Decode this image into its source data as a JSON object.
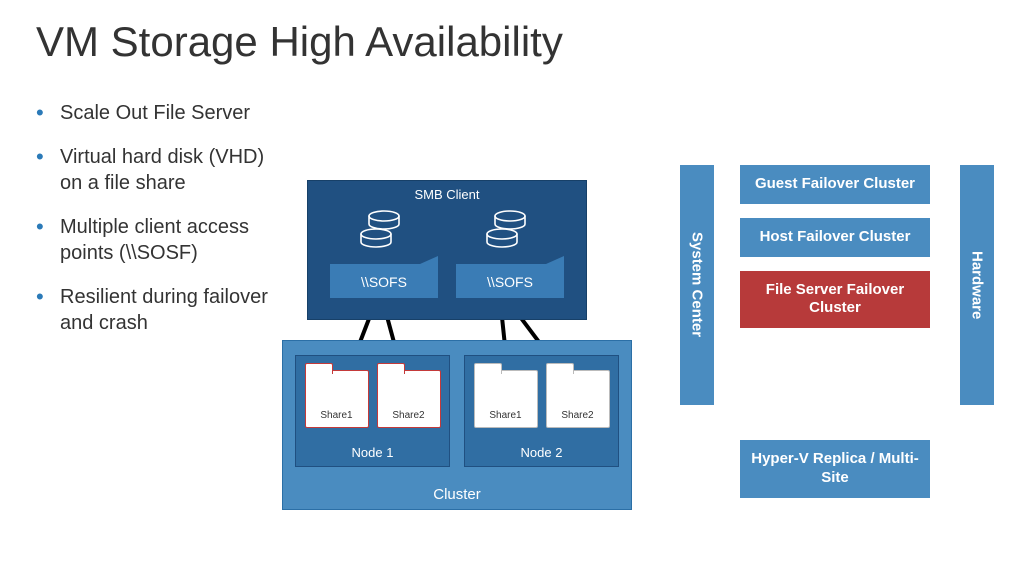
{
  "title": "VM Storage High Availability",
  "bullets": [
    "Scale Out File Server",
    "Virtual hard disk (VHD) on a file share",
    "Multiple client access points (\\\\SOSF)",
    "Resilient during failover and crash"
  ],
  "smb": {
    "label": "SMB Client",
    "sofs": [
      "\\\\SOFS",
      "\\\\SOFS"
    ]
  },
  "cluster": {
    "label": "Cluster",
    "nodes": [
      {
        "label": "Node 1",
        "shares": [
          "Share1",
          "Share2"
        ]
      },
      {
        "label": "Node 2",
        "shares": [
          "Share1",
          "Share2"
        ]
      }
    ]
  },
  "sidebars": {
    "system_center": "System Center",
    "hardware": "Hardware"
  },
  "stack": {
    "guest": "Guest Failover Cluster",
    "host": "Host Failover Cluster",
    "fileserver": "File Server Failover Cluster",
    "hyperv": "Hyper-V Replica / Multi-Site"
  }
}
